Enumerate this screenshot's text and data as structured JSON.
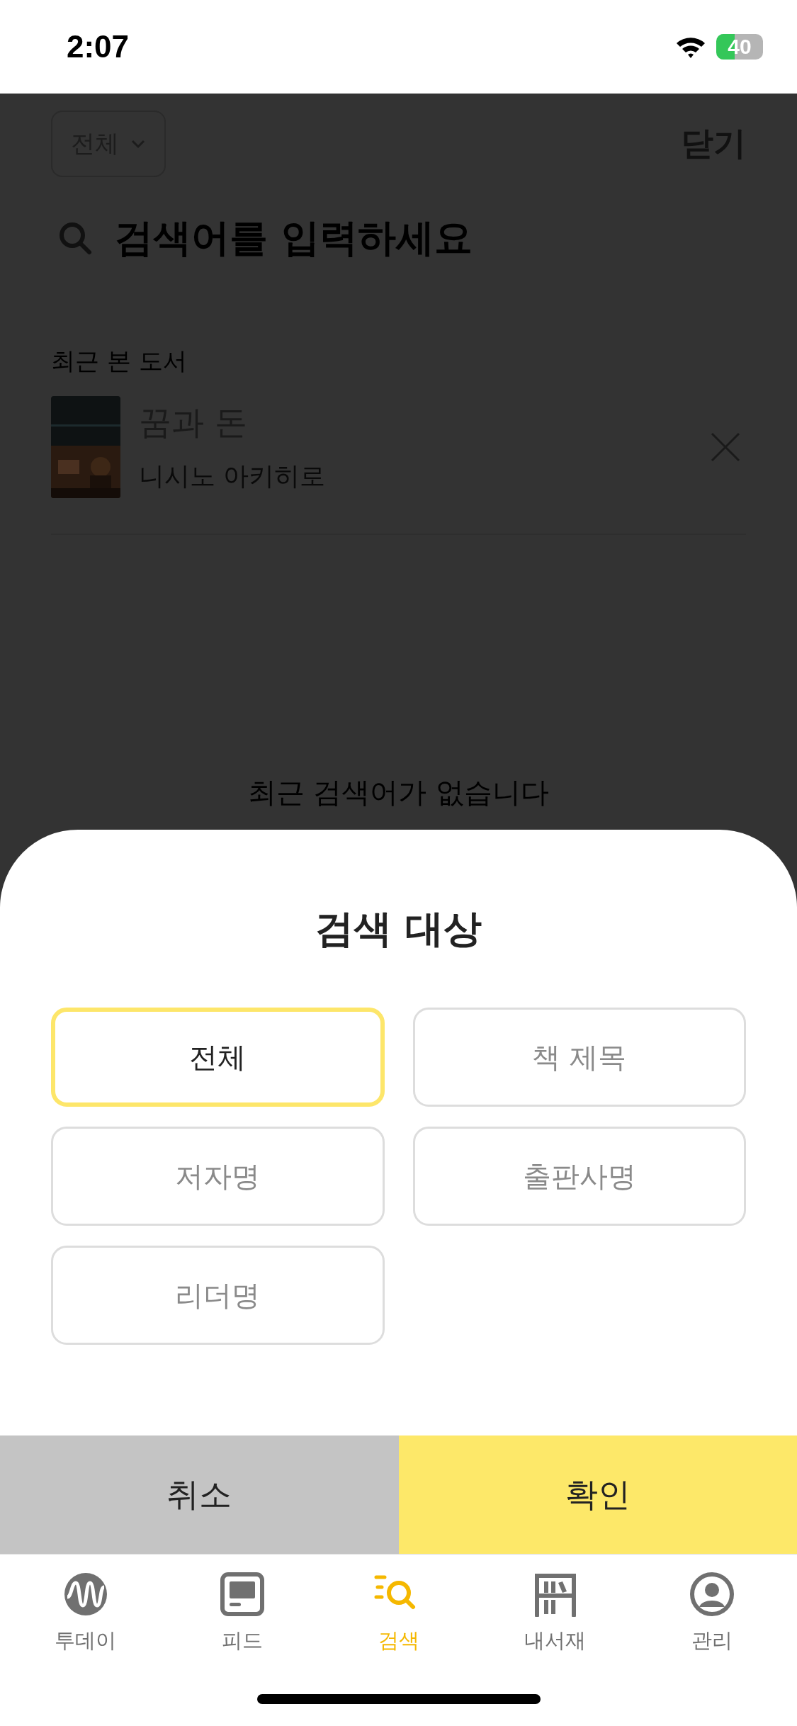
{
  "status_bar": {
    "time": "2:07",
    "battery": "40"
  },
  "header": {
    "filter": "전체",
    "close": "닫기"
  },
  "search": {
    "placeholder": "검색어를 입력하세요"
  },
  "recent_books": {
    "heading": "최근 본 도서",
    "items": [
      {
        "title": "꿈과 돈",
        "author": "니시노 아키히로"
      }
    ]
  },
  "empty_state": {
    "lines": [
      "최근 검색어가 없습니다"
    ]
  },
  "sheet": {
    "title": "검색 대상",
    "options": [
      {
        "label": "전체",
        "selected": true
      },
      {
        "label": "책 제목",
        "selected": false
      },
      {
        "label": "저자명",
        "selected": false
      },
      {
        "label": "출판사명",
        "selected": false
      },
      {
        "label": "리더명",
        "selected": false
      }
    ],
    "buttons": [
      {
        "label": "취소",
        "kind": "cancel"
      },
      {
        "label": "확인",
        "kind": "confirm"
      }
    ]
  },
  "tab_bar": [
    {
      "label": "투데이",
      "kind": "today",
      "selected": false
    },
    {
      "label": "피드",
      "kind": "feed",
      "selected": false
    },
    {
      "label": "검색",
      "kind": "search",
      "selected": true
    },
    {
      "label": "내서재",
      "kind": "library",
      "selected": false
    },
    {
      "label": "관리",
      "kind": "account",
      "selected": false
    }
  ]
}
